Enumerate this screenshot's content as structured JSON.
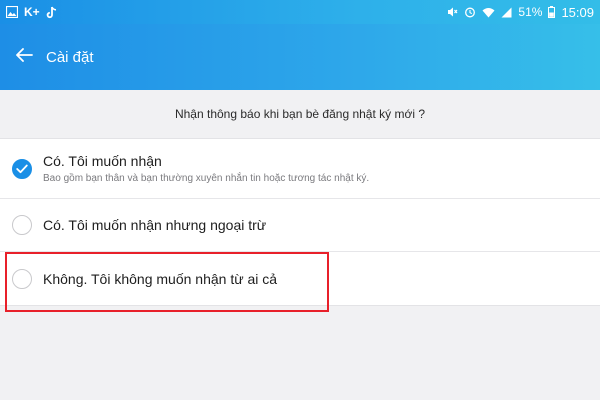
{
  "status_bar": {
    "left_icons": [
      "image-icon",
      "kplus-icon",
      "tiktok-icon"
    ],
    "carrier_label": "K+",
    "right_icons": [
      "mute-icon",
      "alarm-icon",
      "wifi-icon",
      "signal-icon",
      "battery-icon"
    ],
    "battery": "51%",
    "time": "15:09"
  },
  "app_bar": {
    "back_icon": "arrow-left-icon",
    "title": "Cài đặt"
  },
  "question": "Nhận thông báo khi bạn bè đăng nhật ký mới ?",
  "options": [
    {
      "title": "Có. Tôi muốn nhận",
      "subtitle": "Bao gồm bạn thân và bạn thường xuyên nhắn tin hoặc tương tác nhật ký.",
      "selected": true
    },
    {
      "title": "Có. Tôi muốn nhận nhưng ngoại trừ",
      "subtitle": "",
      "selected": false
    },
    {
      "title": "Không. Tôi không muốn nhận từ ai cả",
      "subtitle": "",
      "selected": false
    }
  ],
  "colors": {
    "accent": "#1a8fe6",
    "highlight": "#e8202a"
  }
}
